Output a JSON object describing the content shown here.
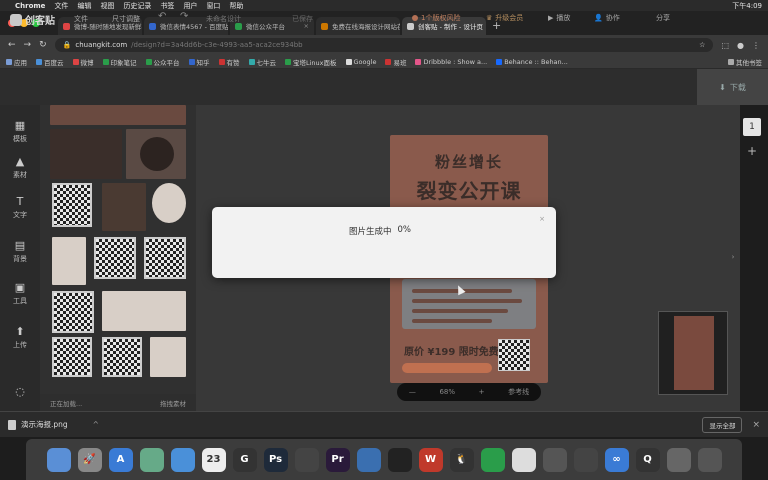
{
  "menubar": {
    "app": "Chrome",
    "items": [
      "文件",
      "编辑",
      "视图",
      "历史记录",
      "书签",
      "用户",
      "窗口",
      "帮助"
    ],
    "clock": "下午4:09"
  },
  "tabs": [
    {
      "label": "微博-随时随地发现新鲜事"
    },
    {
      "label": "微信表情4567 - 百度贴吧"
    },
    {
      "label": "微信公众平台"
    },
    {
      "label": "免费在线海报设计网站在线制"
    },
    {
      "label": "创客贴 - 制作 - 设计页"
    }
  ],
  "active_tab": 4,
  "address": {
    "host": "chuangkit.com",
    "path": "/design?d=3a4dd6b-c3e-4993-aa5-aca2ce934bb"
  },
  "bookmarks": [
    "应用",
    "百度云",
    "微博",
    "印象笔记",
    "公众平台",
    "知乎",
    "有赞",
    "七牛云",
    "宝塔Linux面板",
    "Google",
    "易班",
    "Dribbble : Show a...",
    "Behance :: Behan..."
  ],
  "bookmarks_other": "其他书签",
  "app": {
    "logo": "创客贴",
    "nav": [
      "文件",
      "尺寸调整"
    ],
    "doc_title": "未命名设计",
    "status": "已保存",
    "copyright": "1个版权风险",
    "upgrade": "升级会员",
    "share_btn": "播放",
    "collab": "协作",
    "share": "分享",
    "download": "下载"
  },
  "rail": [
    "模板",
    "素材",
    "文字",
    "背景",
    "工具",
    "上传"
  ],
  "panel_footer": {
    "left": "正在加载...",
    "right": "拖拽素材"
  },
  "poster": {
    "title1": "粉丝增长",
    "title2": "裂变公开课",
    "price": "原价 ¥199 限时免费"
  },
  "zoom": {
    "minus": "—",
    "value": "68%",
    "plus": "+",
    "ref": "参考线"
  },
  "page_label": "1",
  "modal": {
    "text": "图片生成中",
    "progress": "0%",
    "progress_value": 0,
    "close": "×"
  },
  "download_bar": {
    "file": "演示海报.png",
    "show_all": "显示全部"
  },
  "dock": [
    {
      "name": "finder-icon",
      "bg": "#5a8fd6",
      "glyph": ""
    },
    {
      "name": "launchpad-icon",
      "bg": "#888",
      "glyph": "🚀"
    },
    {
      "name": "appstore-icon",
      "bg": "#3a7bd5",
      "glyph": "A"
    },
    {
      "name": "preview-icon",
      "bg": "#6a8",
      "glyph": ""
    },
    {
      "name": "safari-icon",
      "bg": "#4a90d9",
      "glyph": ""
    },
    {
      "name": "calendar-icon",
      "bg": "#eee",
      "glyph": "23"
    },
    {
      "name": "browser-icon",
      "bg": "#333",
      "glyph": "G"
    },
    {
      "name": "photoshop-icon",
      "bg": "#1e2a3a",
      "glyph": "Ps"
    },
    {
      "name": "chrome-icon",
      "bg": "#444",
      "glyph": ""
    },
    {
      "name": "premiere-icon",
      "bg": "#2a1a3a",
      "glyph": "Pr"
    },
    {
      "name": "keynote-icon",
      "bg": "#3a6fb0",
      "glyph": ""
    },
    {
      "name": "music-icon",
      "bg": "#222",
      "glyph": ""
    },
    {
      "name": "wps-icon",
      "bg": "#c0392b",
      "glyph": "W"
    },
    {
      "name": "qq-icon",
      "bg": "#333",
      "glyph": "🐧"
    },
    {
      "name": "wechat-icon",
      "bg": "#2a9d4a",
      "glyph": ""
    },
    {
      "name": "notes-icon",
      "bg": "#ddd",
      "glyph": ""
    },
    {
      "name": "fingerprint-icon",
      "bg": "#555",
      "glyph": ""
    },
    {
      "name": "sketch-icon",
      "bg": "#444",
      "glyph": ""
    },
    {
      "name": "baidu-netdisk-icon",
      "bg": "#3a7bd5",
      "glyph": "∞"
    },
    {
      "name": "quicktime-icon",
      "bg": "#333",
      "glyph": "Q"
    },
    {
      "name": "photos-icon",
      "bg": "#666",
      "glyph": ""
    },
    {
      "name": "trash-icon",
      "bg": "#555",
      "glyph": ""
    }
  ]
}
